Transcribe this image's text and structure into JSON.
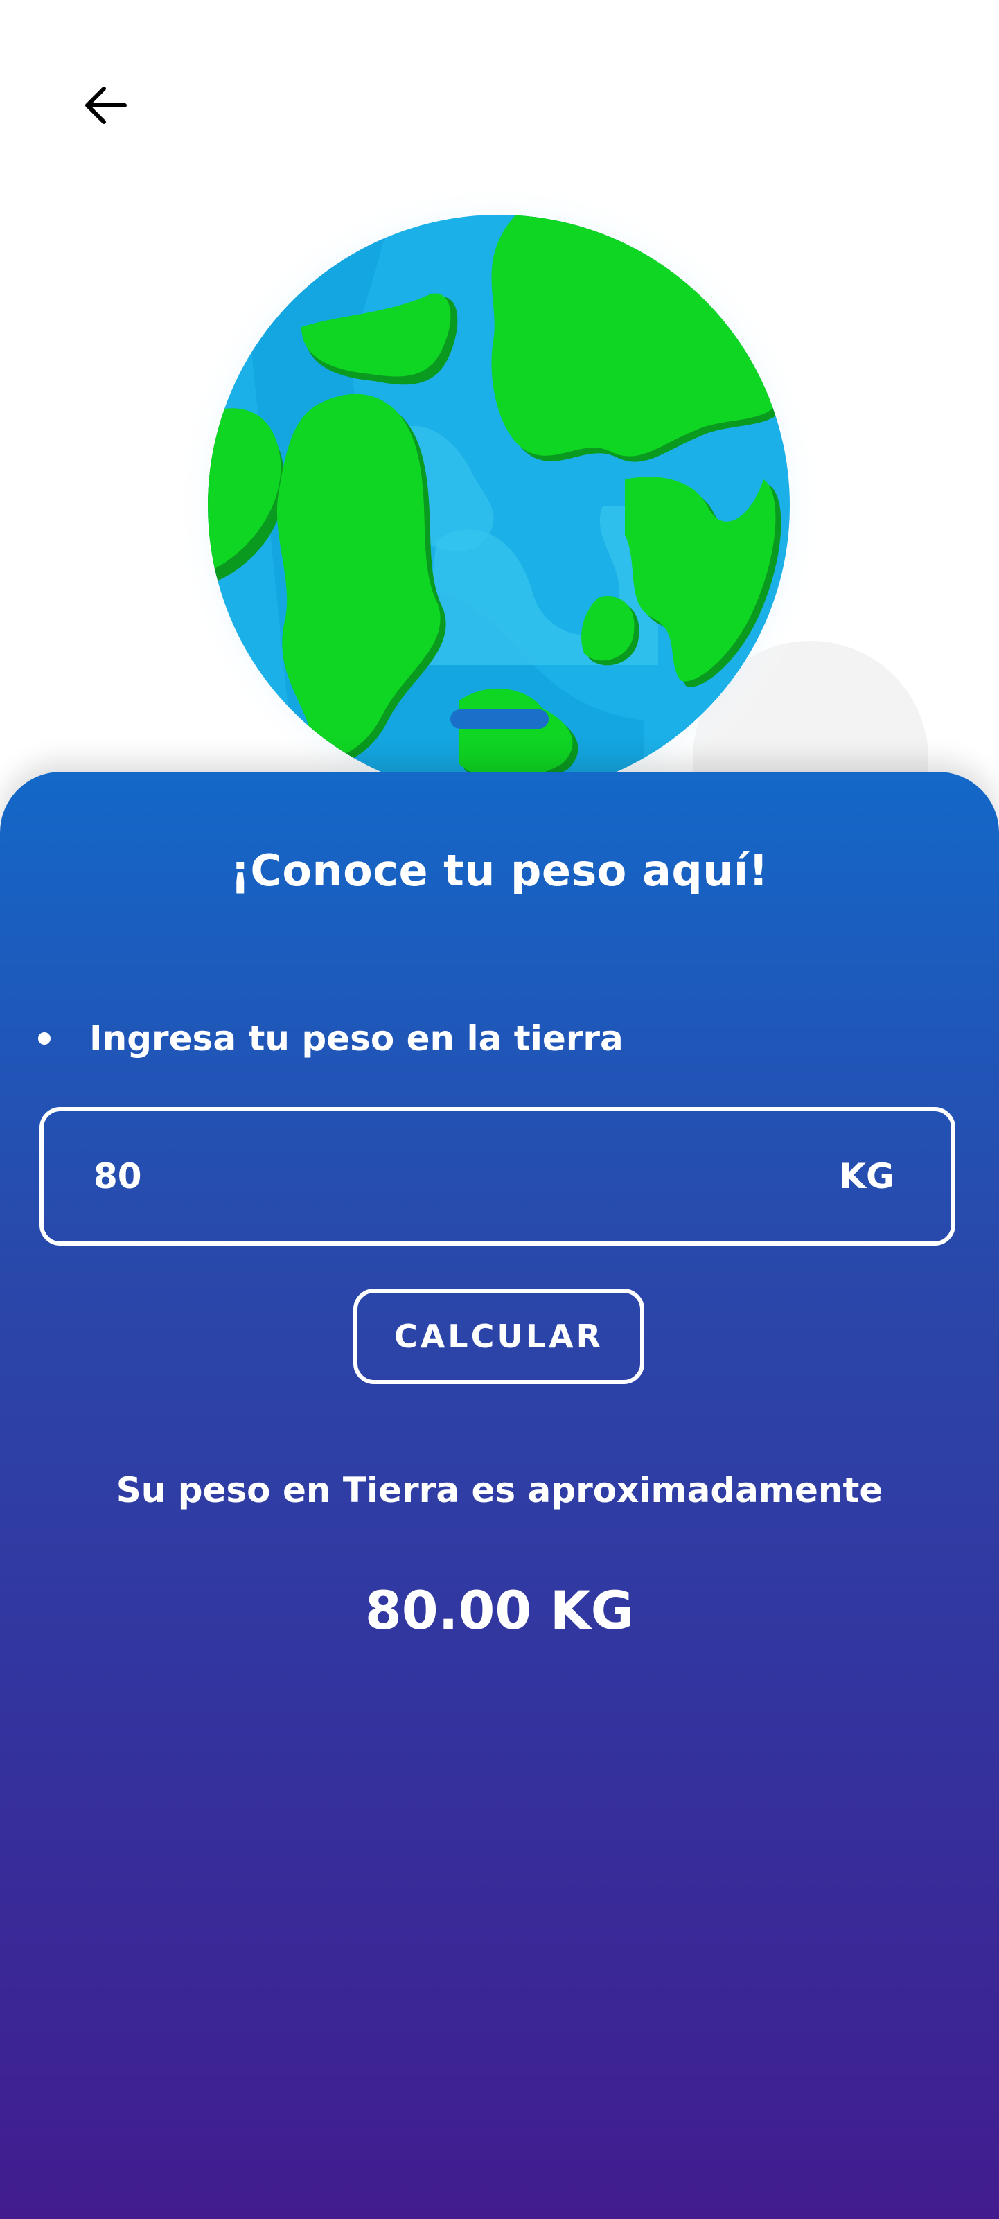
{
  "header": {
    "back_icon": "arrow-left-icon"
  },
  "illustration": {
    "icon": "earth-globe-icon",
    "colors": {
      "ocean": "#1cb0e8",
      "ocean_light": "#37c6f0",
      "land": "#0fd523",
      "land_shadow": "#0a9a1f"
    }
  },
  "sheet": {
    "title": "¡Conoce tu peso aquí!",
    "instruction": "Ingresa tu peso en la tierra",
    "weight_input": {
      "value": "80",
      "unit": "KG"
    },
    "calculate_label": "CALCULAR",
    "result_caption": "Su peso en Tierra es aproximadamente",
    "result_value": "80.00 KG",
    "colors": {
      "gradient_top": "#1368c8",
      "gradient_bottom": "#421c8f",
      "text": "#ffffff"
    }
  }
}
